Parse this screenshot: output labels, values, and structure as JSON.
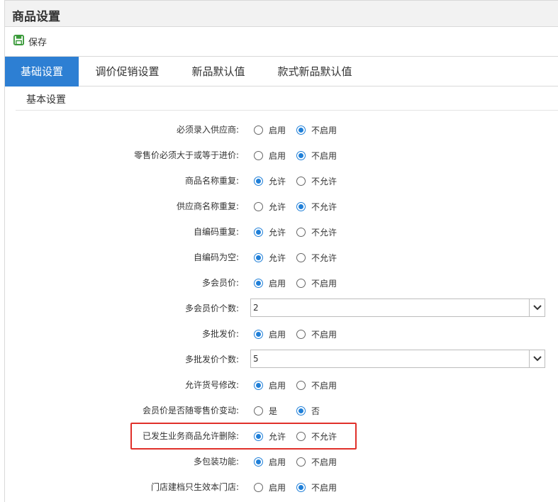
{
  "header": {
    "title": "商品设置"
  },
  "toolbar": {
    "save_label": "保存"
  },
  "tabs": [
    {
      "label": "基础设置",
      "active": true
    },
    {
      "label": "调价促销设置",
      "active": false
    },
    {
      "label": "新品默认值",
      "active": false
    },
    {
      "label": "款式新品默认值",
      "active": false
    }
  ],
  "section": {
    "title": "基本设置"
  },
  "settings": [
    {
      "label": "必须录入供应商:",
      "options": [
        "启用",
        "不启用"
      ],
      "selected": 1
    },
    {
      "label": "零售价必须大于或等于进价:",
      "options": [
        "启用",
        "不启用"
      ],
      "selected": 1
    },
    {
      "label": "商品名称重复:",
      "options": [
        "允许",
        "不允许"
      ],
      "selected": 0
    },
    {
      "label": "供应商名称重复:",
      "options": [
        "允许",
        "不允许"
      ],
      "selected": 1
    },
    {
      "label": "自编码重复:",
      "options": [
        "允许",
        "不允许"
      ],
      "selected": 0
    },
    {
      "label": "自编码为空:",
      "options": [
        "允许",
        "不允许"
      ],
      "selected": 0
    },
    {
      "label": "多会员价:",
      "options": [
        "启用",
        "不启用"
      ],
      "selected": 0
    },
    {
      "label": "多会员价个数:",
      "select": "2"
    },
    {
      "label": "多批发价:",
      "options": [
        "启用",
        "不启用"
      ],
      "selected": 0
    },
    {
      "label": "多批发价个数:",
      "select": "5"
    },
    {
      "label": "允许货号修改:",
      "options": [
        "启用",
        "不启用"
      ],
      "selected": 0
    },
    {
      "label": "会员价是否随零售价变动:",
      "options": [
        "是",
        "否"
      ],
      "selected": 1
    },
    {
      "label": "已发生业务商品允许删除:",
      "options": [
        "允许",
        "不允许"
      ],
      "selected": 0,
      "highlighted": true
    },
    {
      "label": "多包装功能:",
      "options": [
        "启用",
        "不启用"
      ],
      "selected": 0
    },
    {
      "label": "门店建档只生效本门店:",
      "options": [
        "启用",
        "不启用"
      ],
      "selected": 1
    }
  ],
  "colors": {
    "accent": "#2d7fd3",
    "radio": "#1f7fd8",
    "highlight": "#e0302a",
    "save_icon": "#3a9a3a"
  }
}
